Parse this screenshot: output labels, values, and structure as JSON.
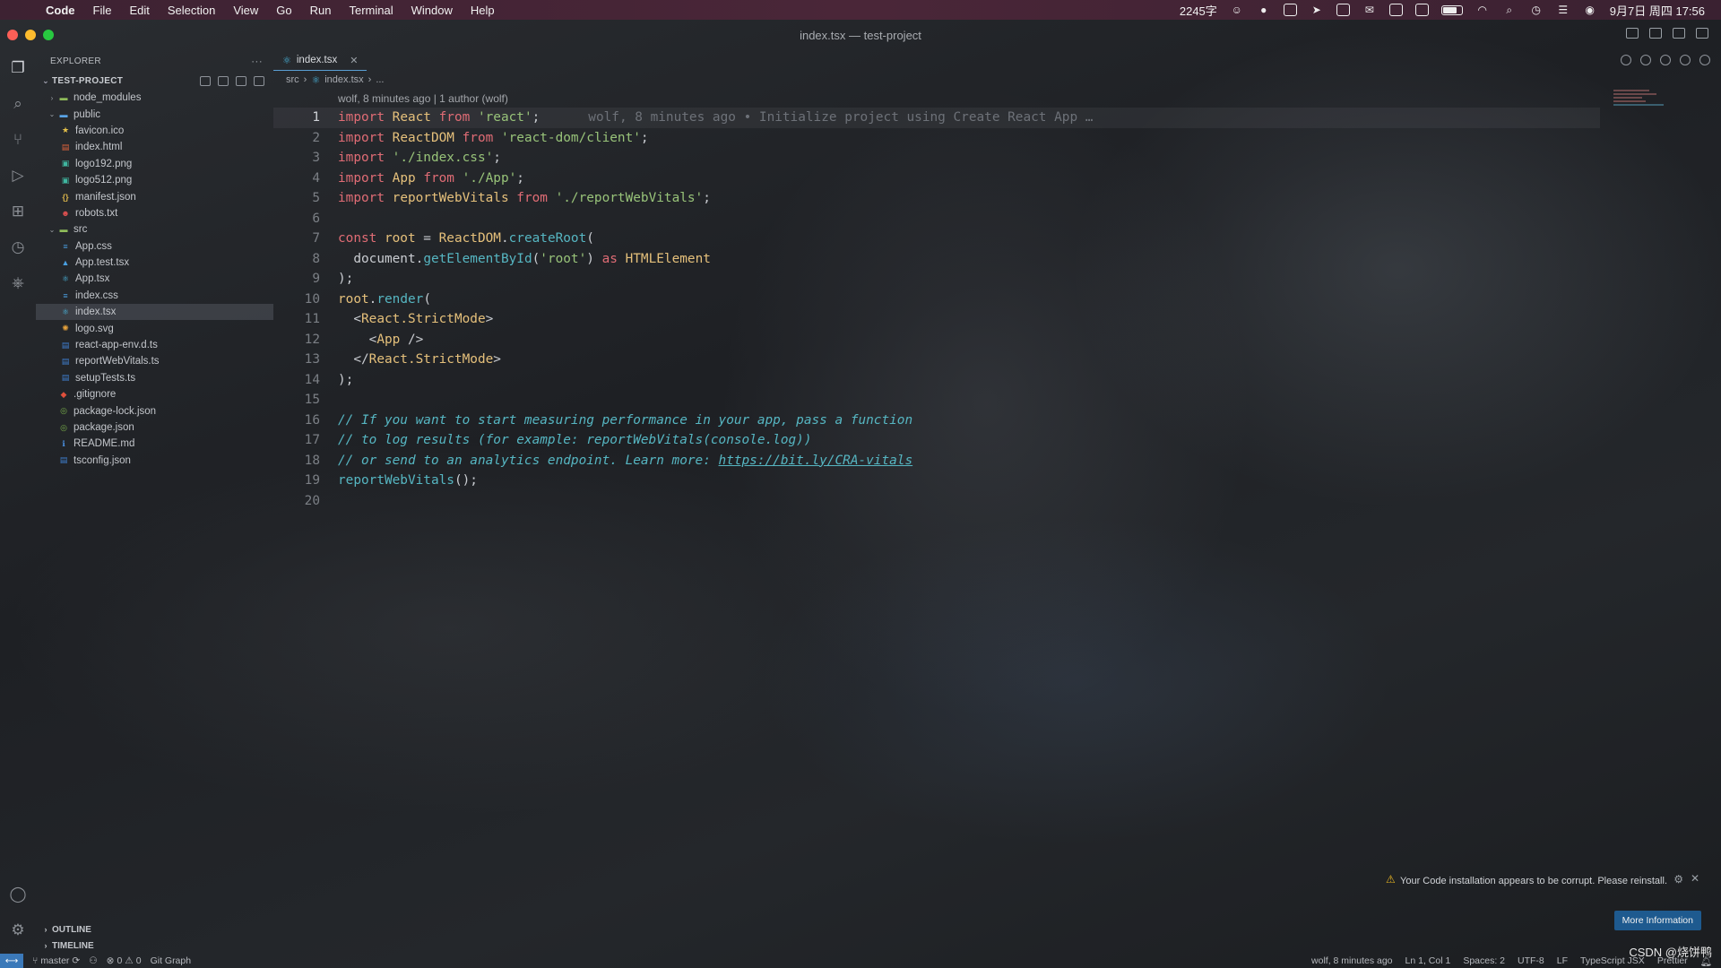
{
  "menubar": {
    "apple": "",
    "items": [
      "Code",
      "File",
      "Edit",
      "Selection",
      "View",
      "Go",
      "Run",
      "Terminal",
      "Window",
      "Help"
    ],
    "word_count": "2245字",
    "datetime": "9月7日 周四 17:56"
  },
  "window": {
    "title": "index.tsx — test-project"
  },
  "explorer": {
    "header": "EXPLORER",
    "more": "···",
    "project": "TEST-PROJECT",
    "tree": [
      {
        "name": "node_modules",
        "type": "folder",
        "open": false,
        "depth": 0,
        "color": "#8fbc5a"
      },
      {
        "name": "public",
        "type": "folder",
        "open": true,
        "depth": 0,
        "color": "#5aa4e6"
      },
      {
        "name": "favicon.ico",
        "type": "file",
        "depth": 1,
        "icon": "★",
        "color": "#e6c24a"
      },
      {
        "name": "index.html",
        "type": "file",
        "depth": 1,
        "icon": "▤",
        "color": "#e0643c"
      },
      {
        "name": "logo192.png",
        "type": "file",
        "depth": 1,
        "icon": "▣",
        "color": "#3fb6a0"
      },
      {
        "name": "logo512.png",
        "type": "file",
        "depth": 1,
        "icon": "▣",
        "color": "#3fb6a0"
      },
      {
        "name": "manifest.json",
        "type": "file",
        "depth": 1,
        "icon": "{}",
        "color": "#d7b24a"
      },
      {
        "name": "robots.txt",
        "type": "file",
        "depth": 1,
        "icon": "☻",
        "color": "#e05050"
      },
      {
        "name": "src",
        "type": "folder",
        "open": true,
        "depth": 0,
        "color": "#8fbc5a"
      },
      {
        "name": "App.css",
        "type": "file",
        "depth": 1,
        "icon": "≡",
        "color": "#4a9fe0"
      },
      {
        "name": "App.test.tsx",
        "type": "file",
        "depth": 1,
        "icon": "▲",
        "color": "#4a9fe0"
      },
      {
        "name": "App.tsx",
        "type": "file",
        "depth": 1,
        "icon": "⚛",
        "color": "#4ab8e0"
      },
      {
        "name": "index.css",
        "type": "file",
        "depth": 1,
        "icon": "≡",
        "color": "#4a9fe0"
      },
      {
        "name": "index.tsx",
        "type": "file",
        "depth": 1,
        "icon": "⚛",
        "color": "#4ab8e0",
        "selected": true
      },
      {
        "name": "logo.svg",
        "type": "file",
        "depth": 1,
        "icon": "✺",
        "color": "#e6a23c"
      },
      {
        "name": "react-app-env.d.ts",
        "type": "file",
        "depth": 1,
        "icon": "▤",
        "color": "#3f7fd0"
      },
      {
        "name": "reportWebVitals.ts",
        "type": "file",
        "depth": 1,
        "icon": "▤",
        "color": "#3f7fd0"
      },
      {
        "name": "setupTests.ts",
        "type": "file",
        "depth": 1,
        "icon": "▤",
        "color": "#3f7fd0"
      },
      {
        "name": ".gitignore",
        "type": "file",
        "depth": 0,
        "icon": "◆",
        "color": "#e0503c"
      },
      {
        "name": "package-lock.json",
        "type": "file",
        "depth": 0,
        "icon": "◎",
        "color": "#7ab04a"
      },
      {
        "name": "package.json",
        "type": "file",
        "depth": 0,
        "icon": "◎",
        "color": "#7ab04a"
      },
      {
        "name": "README.md",
        "type": "file",
        "depth": 0,
        "icon": "ℹ",
        "color": "#4a8fe0"
      },
      {
        "name": "tsconfig.json",
        "type": "file",
        "depth": 0,
        "icon": "▤",
        "color": "#3f7fd0"
      }
    ],
    "outline": "OUTLINE",
    "timeline": "TIMELINE"
  },
  "editor": {
    "tab": "index.tsx",
    "breadcrumb": [
      "src",
      "index.tsx",
      "..."
    ],
    "blame_header": "wolf, 8 minutes ago | 1 author (wolf)",
    "blame_inline": "wolf, 8 minutes ago • Initialize project using Create React App …",
    "lines": [
      [
        [
          "kw",
          "import "
        ],
        [
          "var",
          "React"
        ],
        [
          "kw",
          " from "
        ],
        [
          "str",
          "'react'"
        ],
        [
          "punc",
          ";"
        ]
      ],
      [
        [
          "kw",
          "import "
        ],
        [
          "var",
          "ReactDOM"
        ],
        [
          "kw",
          " from "
        ],
        [
          "str",
          "'react-dom/client'"
        ],
        [
          "punc",
          ";"
        ]
      ],
      [
        [
          "kw",
          "import "
        ],
        [
          "str",
          "'./index.css'"
        ],
        [
          "punc",
          ";"
        ]
      ],
      [
        [
          "kw",
          "import "
        ],
        [
          "var",
          "App"
        ],
        [
          "kw",
          " from "
        ],
        [
          "str",
          "'./App'"
        ],
        [
          "punc",
          ";"
        ]
      ],
      [
        [
          "kw",
          "import "
        ],
        [
          "var",
          "reportWebVitals"
        ],
        [
          "kw",
          " from "
        ],
        [
          "str",
          "'./reportWebVitals'"
        ],
        [
          "punc",
          ";"
        ]
      ],
      [],
      [
        [
          "kw",
          "const "
        ],
        [
          "var",
          "root"
        ],
        [
          "punc",
          " = "
        ],
        [
          "var",
          "ReactDOM"
        ],
        [
          "punc",
          "."
        ],
        [
          "fn",
          "createRoot"
        ],
        [
          "punc",
          "("
        ]
      ],
      [
        [
          "punc",
          "  document."
        ],
        [
          "fn",
          "getElementById"
        ],
        [
          "punc",
          "("
        ],
        [
          "str",
          "'root'"
        ],
        [
          "punc",
          ") "
        ],
        [
          "kw",
          "as "
        ],
        [
          "ty",
          "HTMLElement"
        ]
      ],
      [
        [
          "punc",
          ");"
        ]
      ],
      [
        [
          "var",
          "root"
        ],
        [
          "punc",
          "."
        ],
        [
          "fn",
          "render"
        ],
        [
          "punc",
          "("
        ]
      ],
      [
        [
          "punc",
          "  <"
        ],
        [
          "jsx",
          "React.StrictMode"
        ],
        [
          "punc",
          ">"
        ]
      ],
      [
        [
          "punc",
          "    <"
        ],
        [
          "jsx",
          "App"
        ],
        [
          "punc",
          " />"
        ]
      ],
      [
        [
          "punc",
          "  </"
        ],
        [
          "jsx",
          "React.StrictMode"
        ],
        [
          "punc",
          ">"
        ]
      ],
      [
        [
          "punc",
          ");"
        ]
      ],
      [],
      [
        [
          "cm",
          "// If you want to start measuring performance in your app, pass a function"
        ]
      ],
      [
        [
          "cm",
          "// to log results (for example: reportWebVitals(console.log))"
        ]
      ],
      [
        [
          "cm",
          "// or send to an analytics endpoint. Learn more: "
        ],
        [
          "link",
          "https://bit.ly/CRA-vitals"
        ]
      ],
      [
        [
          "fn",
          "reportWebVitals"
        ],
        [
          "punc",
          "();"
        ]
      ],
      []
    ]
  },
  "notification": {
    "message": "Your Code installation appears to be corrupt. Please reinstall.",
    "button": "More Information"
  },
  "statusbar": {
    "branch": "master",
    "errors": "0",
    "warnings": "0",
    "git_graph": "Git Graph",
    "blame": "wolf, 8 minutes ago",
    "position": "Ln 1, Col 1",
    "spaces": "Spaces: 2",
    "encoding": "UTF-8",
    "eol": "LF",
    "language": "TypeScript JSX",
    "prettier": "Prettier"
  },
  "watermark": "CSDN @烧饼鸭"
}
